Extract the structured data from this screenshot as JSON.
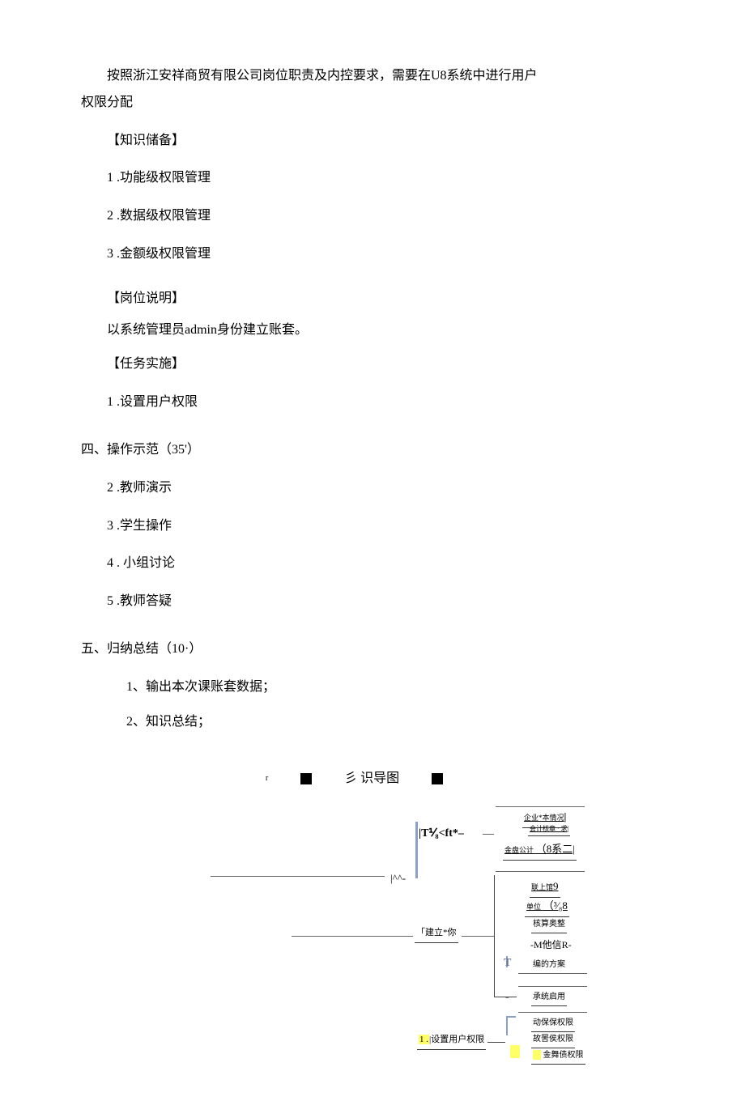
{
  "intro": {
    "line1": "按照浙江安祥商贸有限公司岗位职责及内控要求，需要在U8系统中进行用户",
    "line2": "权限分配"
  },
  "sections": {
    "knowledge": {
      "heading": "【知识储备】",
      "items": [
        "1  .功能级权限管理",
        "2   .数据级权限管理",
        "3   .金额级权限管理"
      ]
    },
    "position": {
      "heading": "【岗位说明】",
      "body": "以系统管理员admin身份建立账套。"
    },
    "task": {
      "heading": "【任务实施】",
      "items": [
        "1  .设置用户权限"
      ]
    },
    "demo": {
      "heading": "四、操作示范（35'）",
      "items": [
        "2   .教师演示",
        "3   .学生操作",
        "4  .  小组讨论",
        "5   .教师答疑"
      ]
    },
    "summary": {
      "heading": "五、归纳总结（10·）",
      "items": [
        "1、输出本次课账套数据；",
        "2、知识总结；"
      ]
    }
  },
  "diagram": {
    "title_mid": "彡  识导图",
    "left_sub": "r",
    "root": "|^^-",
    "branch_top": "|T⅟₈<ft*–",
    "branch_mid": "「建立*你",
    "branch_bot_prefix": "1 .",
    "branch_bot_label": "|设置用户权限",
    "leaves": {
      "a1": "企业*本情况",
      "a1_suffix": "|",
      "a2": "会计核章 · 求|",
      "a3_left": "金盘公计",
      "a3_right": "（8系二|",
      "b1_left": "联上馆",
      "b1_right": "9",
      "b2_left": "单位",
      "b2_right": "（³⁄₈8",
      "b3": "核算奥整",
      "b4": "-M他信R-",
      "b5": "编的方案",
      "c1": "承统启用",
      "d1": "动保保权限",
      "d2": "故罟侯权限",
      "d3": "金舞债权限"
    }
  }
}
